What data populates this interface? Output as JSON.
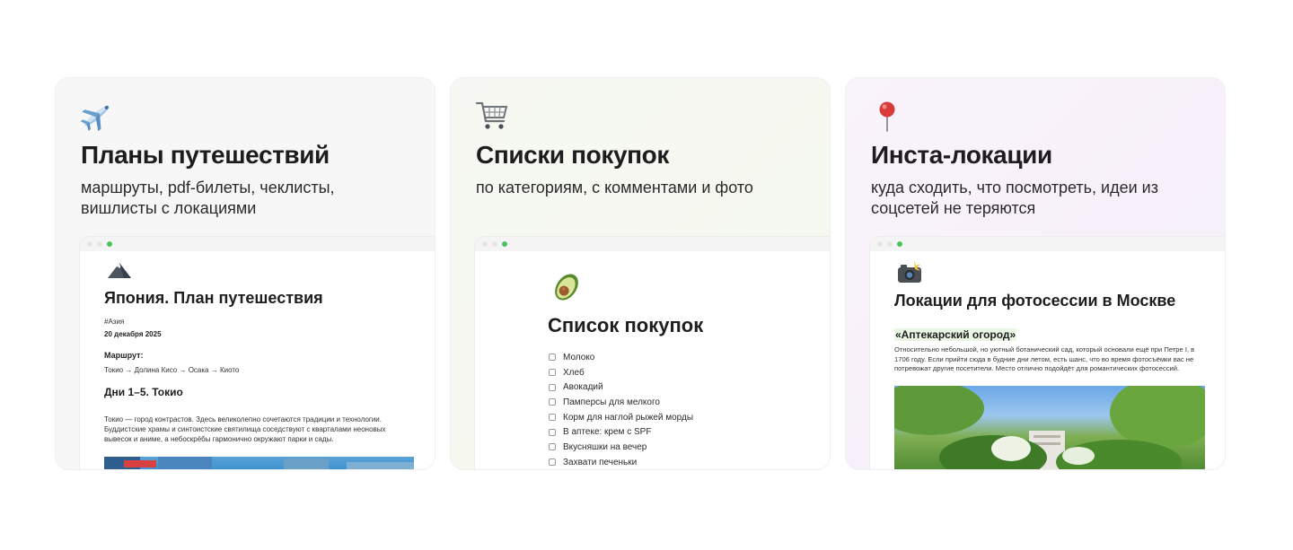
{
  "cards": [
    {
      "emoji_icon": "airplane-icon",
      "title": "Планы путешествий",
      "subtitle": "маршруты, pdf-билеты, чеклисты, вишлисты с локациями",
      "doc": {
        "emoji_icon": "mountain-icon",
        "title": "Япония. План путешествия",
        "tag": "#Азия",
        "date": "20 декабря 2025",
        "route_heading": "Маршрут:",
        "route": "Токио → Долина Кисо → Осака → Киото",
        "section_heading": "Дни 1–5. Токио",
        "body": "Токио — город контрастов. Здесь великолепно сочетаются традиции и технологии. Буддистские храмы и синтоистские святилища соседствуют с кварталами неоновых вывесок и аниме, а небоскрёбы гармонично окружают парки и сады."
      }
    },
    {
      "emoji_icon": "shopping-cart-icon",
      "title": "Списки покупок",
      "subtitle": "по категориям, с комментами и фото",
      "doc": {
        "emoji_icon": "avocado-icon",
        "title": "Список покупок",
        "items": [
          "Молоко",
          "Хлеб",
          "Авокадий",
          "Памперсы для мелкого",
          "Корм для наглой рыжей морды",
          "В аптеке: крем с SPF",
          "Вкусняшки на вечер",
          "Захвати печеньки"
        ]
      }
    },
    {
      "emoji_icon": "round-pushpin-icon",
      "title": "Инста-локации",
      "subtitle": "куда сходить, что посмотреть, идеи из соцсетей не теряются",
      "doc": {
        "emoji_icon": "camera-flash-icon",
        "title": "Локации для фотосессии в Москве",
        "section_heading": "«Аптекарский огород»",
        "body": "Относительно небольшой, но уютный ботанический сад, который основали ещё при Петре I, в 1706 году. Если прийти сюда в будние дни летом, есть шанс, что во время фотосъёмки вас не потревожат другие посетители. Место отлично подойдёт для романтических фотосессий."
      }
    }
  ],
  "colors": {
    "window_dot_active": "#4cc35a",
    "highlight": "#e9f6e4"
  }
}
